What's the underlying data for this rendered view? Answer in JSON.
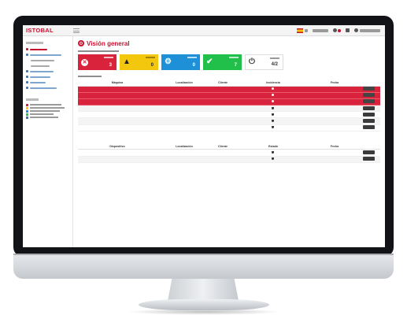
{
  "app": {
    "logo": "ISTOBAL",
    "page_title": "Visión general",
    "page_subtitle": "",
    "notifications_heading": ""
  },
  "topbar": {
    "lang": "",
    "menu1": "",
    "user": ""
  },
  "colors": {
    "brand_red": "#c8102e",
    "alarm_row": "#d9233d",
    "warning": "#f4c70f",
    "info": "#1e90d8",
    "ok": "#20c04a"
  },
  "sidebar": {
    "section1": "",
    "items": [
      {
        "label": "",
        "icon": "home-icon",
        "active": true
      },
      {
        "label": "",
        "icon": "wrench-icon"
      },
      {
        "label": "",
        "icon": "circle-icon",
        "sub": true
      },
      {
        "label": "",
        "icon": "circle-icon",
        "sub": true
      },
      {
        "label": "",
        "icon": "gear-icon"
      },
      {
        "label": "",
        "icon": "chart-icon"
      },
      {
        "label": "",
        "icon": "list-icon"
      },
      {
        "label": "",
        "icon": "user-icon"
      }
    ],
    "section2": "",
    "legend": [
      {
        "label": "",
        "color": "#d9233d"
      },
      {
        "label": "",
        "color": "#f4c70f"
      },
      {
        "label": "",
        "color": "#1e90d8"
      },
      {
        "label": "",
        "color": "#20c04a"
      },
      {
        "label": "",
        "color": "#3a78b5"
      }
    ]
  },
  "cards": [
    {
      "color": "red",
      "icon": "x-circle-icon",
      "count": "3"
    },
    {
      "color": "yellow",
      "icon": "warning-icon",
      "count": "0"
    },
    {
      "color": "blue",
      "icon": "gears-icon",
      "count": "0"
    },
    {
      "color": "green",
      "icon": "check-icon",
      "count": "7"
    },
    {
      "color": "white",
      "icon": "plug-icon",
      "count": "4/2"
    }
  ],
  "table1": {
    "headers": [
      "Máquina",
      "Localización",
      "Cliente",
      "Incidencia",
      "Fecha",
      ""
    ],
    "rows": [
      {
        "status": "alarm",
        "machine": "",
        "location": "",
        "client": "",
        "incident": "",
        "date": "",
        "action": ""
      },
      {
        "status": "alarm",
        "machine": "",
        "location": "",
        "client": "",
        "incident": "",
        "date": "",
        "action": ""
      },
      {
        "status": "alarm",
        "machine": "",
        "location": "",
        "client": "",
        "incident": "",
        "date": "",
        "action": ""
      },
      {
        "status": "ok",
        "machine": "",
        "location": "",
        "client": "",
        "incident": "",
        "date": "",
        "action": ""
      },
      {
        "status": "ok",
        "machine": "",
        "location": "",
        "client": "",
        "incident": "",
        "date": "",
        "action": ""
      },
      {
        "status": "ok",
        "machine": "",
        "location": "",
        "client": "",
        "incident": "",
        "date": "",
        "action": ""
      },
      {
        "status": "ok",
        "machine": "",
        "location": "",
        "client": "",
        "incident": "",
        "date": "",
        "action": ""
      }
    ]
  },
  "table2": {
    "headers": [
      "Dispositivo",
      "Localización",
      "Cliente",
      "Estado",
      "Fecha",
      ""
    ],
    "rows": [
      {
        "device": "",
        "location": "",
        "client": "",
        "state": "",
        "date": "",
        "action": ""
      },
      {
        "device": "",
        "location": "",
        "client": "",
        "state": "",
        "date": "",
        "action": ""
      }
    ]
  }
}
